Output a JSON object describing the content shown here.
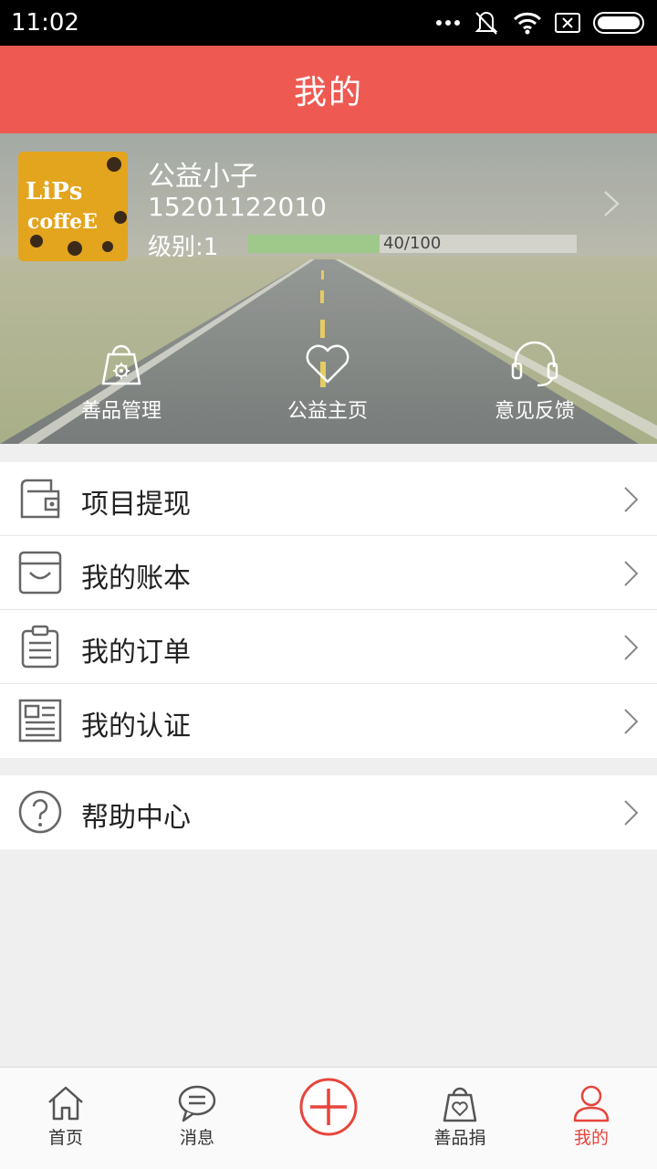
{
  "status_bar": {
    "time": "11:02"
  },
  "header": {
    "title": "我的"
  },
  "profile": {
    "name": "公益小子",
    "phone": "15201122010",
    "level_label": "级别:1",
    "progress_text": "40/100",
    "progress_fraction": 0.4,
    "avatar_text": [
      "LiPs",
      "coffeE"
    ]
  },
  "quick_actions": [
    {
      "label": "善品管理",
      "icon": "bag-gear-icon"
    },
    {
      "label": "公益主页",
      "icon": "heart-icon"
    },
    {
      "label": "意见反馈",
      "icon": "headset-icon"
    }
  ],
  "menu_main": [
    {
      "label": "项目提现",
      "icon": "wallet-icon"
    },
    {
      "label": "我的账本",
      "icon": "ledger-icon"
    },
    {
      "label": "我的订单",
      "icon": "clipboard-icon"
    },
    {
      "label": "我的认证",
      "icon": "certificate-icon"
    }
  ],
  "menu_help": [
    {
      "label": "帮助中心",
      "icon": "question-icon"
    }
  ],
  "tabs": [
    {
      "label": "首页",
      "icon": "home-icon"
    },
    {
      "label": "消息",
      "icon": "message-icon"
    },
    {
      "label": "",
      "icon": "add-circle-icon"
    },
    {
      "label": "善品捐",
      "icon": "bag-heart-icon"
    },
    {
      "label": "我的",
      "icon": "user-icon",
      "active": true
    }
  ],
  "colors": {
    "brand": "#ee5a52",
    "tab_active": "#e6453d",
    "progress": "#9fc98b"
  }
}
